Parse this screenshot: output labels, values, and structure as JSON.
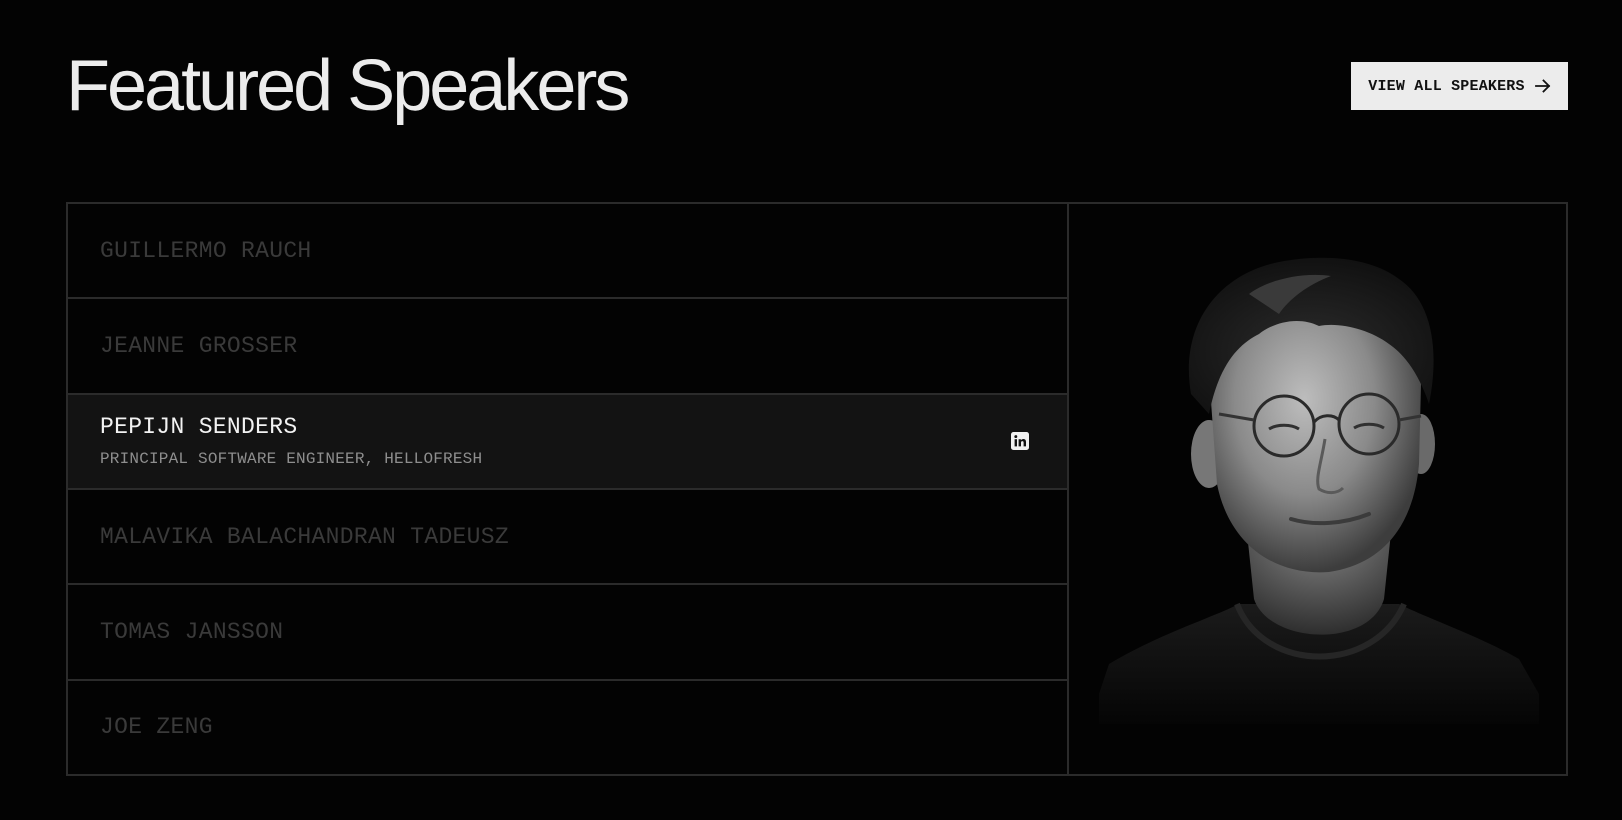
{
  "header": {
    "title": "Featured Speakers",
    "view_all_label": "VIEW ALL SPEAKERS"
  },
  "speakers": [
    {
      "name": "GUILLERMO RAUCH",
      "role": ""
    },
    {
      "name": "JEANNE GROSSER",
      "role": ""
    },
    {
      "name": "PEPIJN SENDERS",
      "role": "PRINCIPAL SOFTWARE ENGINEER, HELLOFRESH",
      "active": true,
      "social_icon": "linkedin-icon"
    },
    {
      "name": "MALAVIKA BALACHANDRAN TADEUSZ",
      "role": ""
    },
    {
      "name": "TOMAS JANSSON",
      "role": ""
    },
    {
      "name": "JOE ZENG",
      "role": ""
    }
  ],
  "colors": {
    "background": "#030303",
    "border": "#2b2b2b",
    "active_row": "#131313",
    "inactive_name": "#3a3a3a",
    "button_bg": "#ececec"
  }
}
